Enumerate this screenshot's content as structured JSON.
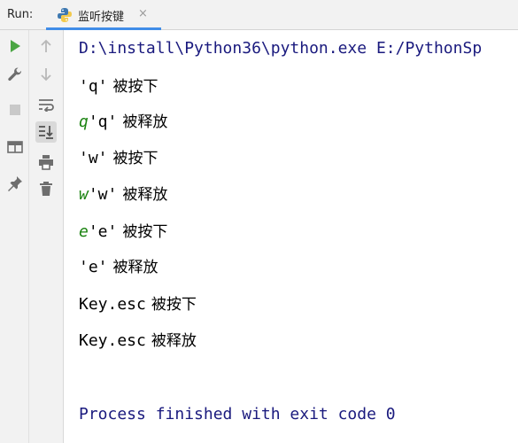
{
  "header": {
    "run_label": "Run:",
    "tab_label": "监听按键",
    "tab_close": "×"
  },
  "console": {
    "command": "D:\\install\\Python36\\python.exe E:/PythonSp",
    "lines": [
      {
        "echo": "",
        "text": "'q'",
        "msg": "被按下"
      },
      {
        "echo": "q",
        "text": "'q'",
        "msg": "被释放"
      },
      {
        "echo": "",
        "text": "'w'",
        "msg": "被按下"
      },
      {
        "echo": "w",
        "text": "'w'",
        "msg": "被释放"
      },
      {
        "echo": "e",
        "text": "'e'",
        "msg": "被按下"
      },
      {
        "echo": "",
        "text": "'e'",
        "msg": "被释放"
      },
      {
        "echo": "",
        "text": "Key.esc",
        "msg": "被按下"
      },
      {
        "echo": "",
        "text": "Key.esc",
        "msg": "被释放"
      }
    ],
    "finished": "Process finished with exit code 0"
  },
  "toolbar_left": [
    "run-icon",
    "wrench-icon",
    "stop-icon",
    "layout-icon",
    "pin-icon"
  ],
  "toolbar_right": [
    "up-arrow-icon",
    "down-arrow-icon",
    "soft-wrap-icon",
    "scroll-to-end-icon",
    "print-icon",
    "trash-icon"
  ],
  "colors": {
    "command": "#1a1a7e",
    "echo": "#19820f",
    "run_green": "#4aa543",
    "tab_underline": "#408de8"
  }
}
